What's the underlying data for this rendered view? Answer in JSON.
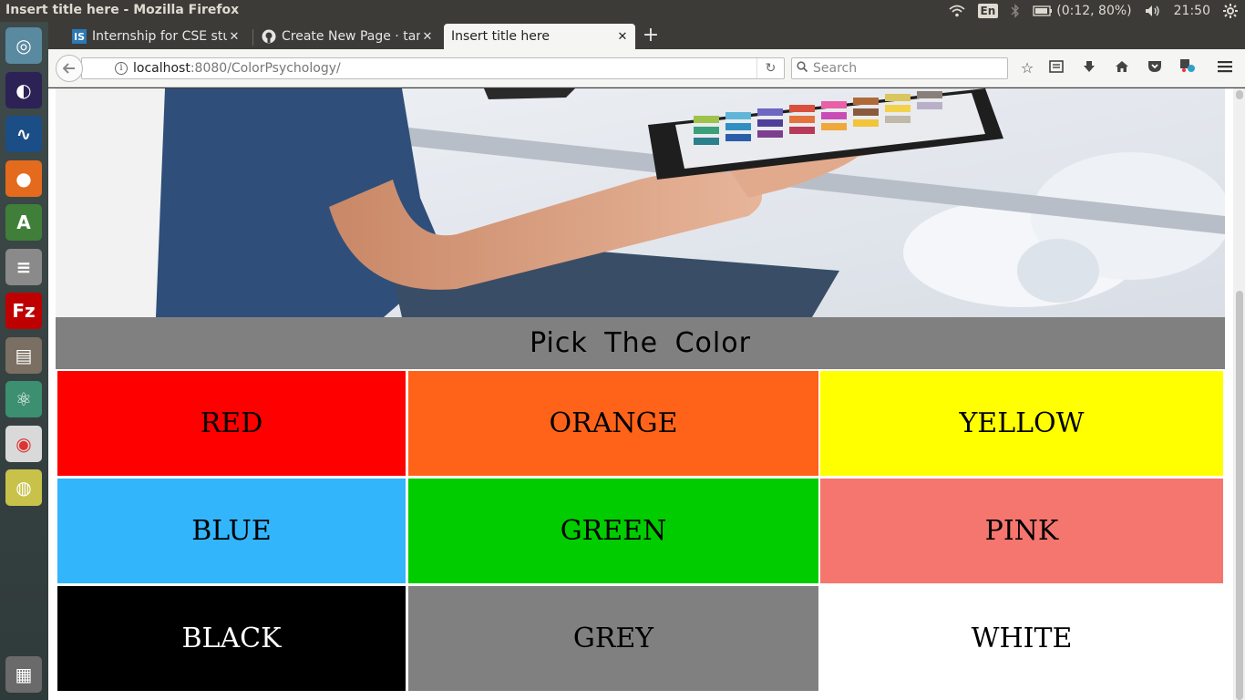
{
  "system": {
    "window_title": "Insert title here - Mozilla Firefox",
    "keyboard_layout": "En",
    "battery": "(0:12, 80%)",
    "clock": "21:50",
    "icons": [
      "wifi-icon",
      "keyboard-layout-icon",
      "bluetooth-icon",
      "battery-icon",
      "volume-icon",
      "settings-gear-icon"
    ]
  },
  "launcher": {
    "items": [
      {
        "name": "ubuntu-dash-icon",
        "color": "#5a8aa0"
      },
      {
        "name": "eclipse-icon",
        "color": "#2c2255"
      },
      {
        "name": "gtkwave-icon",
        "color": "#1b4d86"
      },
      {
        "name": "firefox-icon",
        "color": "#e46b1e"
      },
      {
        "name": "android-studio-icon",
        "color": "#3f7f3a"
      },
      {
        "name": "database-icon",
        "color": "#8a8a8a"
      },
      {
        "name": "filezilla-icon",
        "color": "#bf0000"
      },
      {
        "name": "files-icon",
        "color": "#7a6f62"
      },
      {
        "name": "atom-icon",
        "color": "#3c8f71"
      },
      {
        "name": "chrome-icon",
        "color": "#d9d9d9"
      },
      {
        "name": "speaker-icon",
        "color": "#c8c24a"
      },
      {
        "name": "trash-icon",
        "color": "#6a6a6a"
      }
    ]
  },
  "tabs": [
    {
      "label": "Internship for CSE stud",
      "favicon": "IS",
      "favicon_color": "#2b79b5"
    },
    {
      "label": "Create New Page · tani",
      "favicon": "gh",
      "favicon_color": "#222222"
    },
    {
      "label": "Insert title here",
      "favicon": "",
      "favicon_color": ""
    }
  ],
  "navbar": {
    "url_host": "localhost",
    "url_rest": ":8080/ColorPsychology/",
    "search_placeholder": "Search",
    "tools": [
      "bookmark-star-icon",
      "reading-list-icon",
      "download-icon",
      "home-icon",
      "pocket-icon",
      "extension-icon",
      "menu-icon"
    ]
  },
  "page": {
    "heading": "Pick The Color",
    "colors": [
      {
        "label": "RED",
        "bg": "#ff0000",
        "fg": "#000000"
      },
      {
        "label": "ORANGE",
        "bg": "#ff6319",
        "fg": "#000000"
      },
      {
        "label": "YELLOW",
        "bg": "#ffff00",
        "fg": "#000000"
      },
      {
        "label": "BLUE",
        "bg": "#33b5fb",
        "fg": "#000000"
      },
      {
        "label": "GREEN",
        "bg": "#00cc00",
        "fg": "#000000"
      },
      {
        "label": "PINK",
        "bg": "#f4766f",
        "fg": "#000000"
      },
      {
        "label": "BLACK",
        "bg": "#000000",
        "fg": "#ffffff"
      },
      {
        "label": "GREY",
        "bg": "#808080",
        "fg": "#000000"
      },
      {
        "label": "WHITE",
        "bg": "#ffffff",
        "fg": "#000000"
      }
    ]
  }
}
